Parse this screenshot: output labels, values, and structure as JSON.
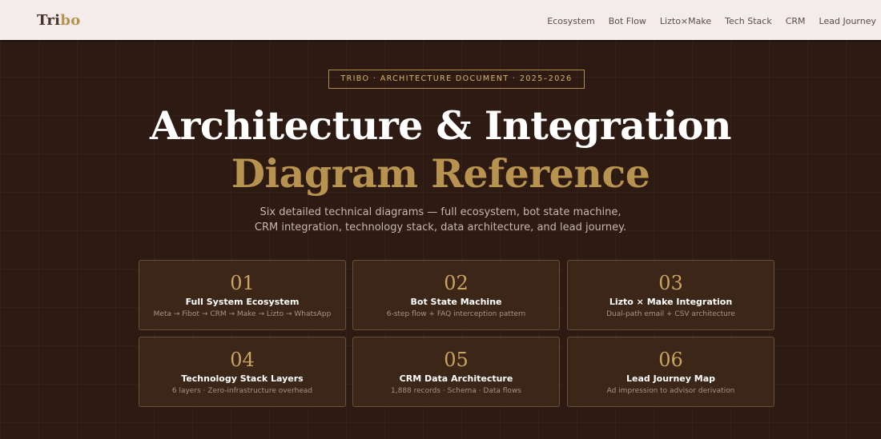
{
  "header": {
    "logo_part1": "Tri",
    "logo_part2": "bo",
    "nav": [
      "Ecosystem",
      "Bot Flow",
      "Lizto×Make",
      "Tech Stack",
      "CRM",
      "Lead Journey"
    ]
  },
  "hero": {
    "eyebrow": "TRIBO · ARCHITECTURE DOCUMENT · 2025–2026",
    "title_line1": "Architecture & Integration",
    "title_line2": "Diagram Reference",
    "subtitle": "Six detailed technical diagrams — full ecosystem, bot state machine, CRM integration, technology stack, data architecture, and lead journey."
  },
  "cards": [
    {
      "num": "01",
      "title": "Full System Ecosystem",
      "desc": "Meta → Fibot → CRM → Make → Lizto → WhatsApp"
    },
    {
      "num": "02",
      "title": "Bot State Machine",
      "desc": "6-step flow + FAQ interception pattern"
    },
    {
      "num": "03",
      "title": "Lizto × Make Integration",
      "desc": "Dual-path email + CSV architecture"
    },
    {
      "num": "04",
      "title": "Technology Stack Layers",
      "desc": "6 layers · Zero-infrastructure overhead"
    },
    {
      "num": "05",
      "title": "CRM Data Architecture",
      "desc": "1,888 records · Schema · Data flows"
    },
    {
      "num": "06",
      "title": "Lead Journey Map",
      "desc": "Ad impression to advisor derivation"
    }
  ],
  "colors": {
    "background": "#2d1a12",
    "navbar": "#f3ecea",
    "accent_gold": "#b8934f",
    "card_bg": "#3b2618"
  }
}
